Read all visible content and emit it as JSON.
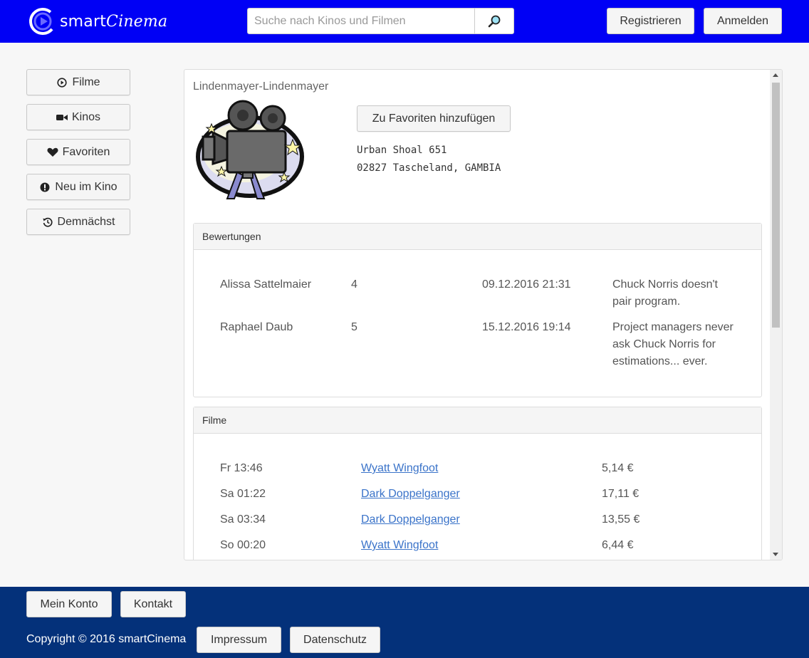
{
  "header": {
    "logo_part1": "smart",
    "logo_part2": "Cinema",
    "search_placeholder": "Suche nach Kinos und Filmen",
    "register_label": "Registrieren",
    "login_label": "Anmelden",
    "brand_color": "#0000f5"
  },
  "sidebar": {
    "items": [
      {
        "label": "Filme",
        "icon": "play-circle-icon"
      },
      {
        "label": "Kinos",
        "icon": "video-camera-icon"
      },
      {
        "label": "Favoriten",
        "icon": "heart-icon"
      },
      {
        "label": "Neu im Kino",
        "icon": "exclamation-circle-icon"
      },
      {
        "label": "Demnächst",
        "icon": "history-icon"
      }
    ]
  },
  "cinema": {
    "name": "Lindenmayer-Lindenmayer",
    "image_icon": "movie-camera-illustration",
    "favorite_button": "Zu Favoriten hinzufügen",
    "address_line1": "Urban Shoal 651",
    "address_line2": "02827 Tascheland, GAMBIA"
  },
  "reviews": {
    "title": "Bewertungen",
    "rows": [
      {
        "author": "Alissa Sattelmaier",
        "rating": "4",
        "date": "09.12.2016 21:31",
        "text_line1": "Chuck Norris doesn't",
        "text_line2": "pair program.",
        "text_line3": ""
      },
      {
        "author": "Raphael Daub",
        "rating": "5",
        "date": "15.12.2016 19:14",
        "text_line1": "Project managers never",
        "text_line2": "ask Chuck Norris for",
        "text_line3": "estimations... ever."
      }
    ]
  },
  "films": {
    "title": "Filme",
    "rows": [
      {
        "time": "Fr 13:46",
        "title": "Wyatt Wingfoot",
        "price": "5,14 €"
      },
      {
        "time": "Sa 01:22",
        "title": "Dark Doppelganger",
        "price": "17,11 €"
      },
      {
        "time": "Sa 03:34",
        "title": "Dark Doppelganger",
        "price": "13,55 €"
      },
      {
        "time": "So 00:20",
        "title": "Wyatt Wingfoot",
        "price": "6,44 €"
      }
    ]
  },
  "footer": {
    "account_label": "Mein Konto",
    "contact_label": "Kontakt",
    "copyright": "Copyright © 2016 smartCinema",
    "imprint_label": "Impressum",
    "privacy_label": "Datenschutz",
    "footer_color": "#04317a"
  }
}
